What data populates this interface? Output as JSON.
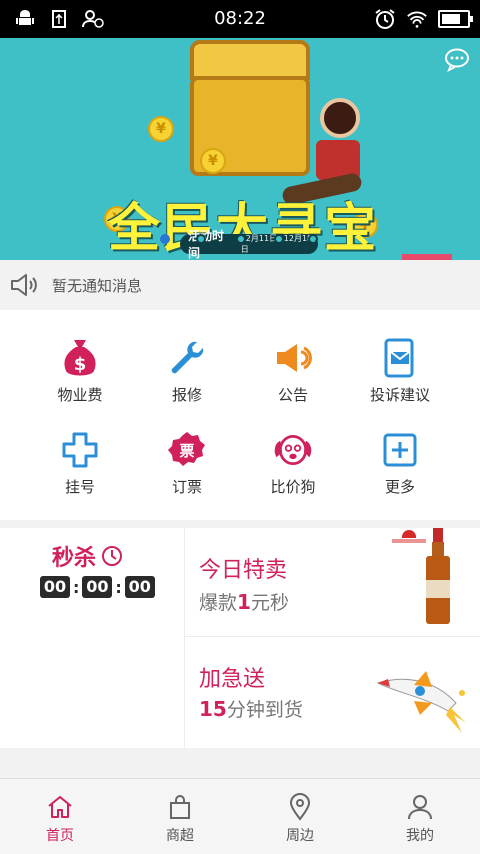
{
  "status_bar": {
    "time": "08:22",
    "battery_level": 0.75
  },
  "banner": {
    "headline": "全民大寻宝",
    "event_label": "活动时间",
    "event_dates": "12月11日~12月18日",
    "coin_symbol": "¥"
  },
  "notice": {
    "text": "暂无通知消息"
  },
  "grid": {
    "items": [
      {
        "label": "物业费",
        "icon": "money-bag-icon",
        "color": "#d0215b"
      },
      {
        "label": "报修",
        "icon": "wrench-icon",
        "color": "#2a8fd6"
      },
      {
        "label": "公告",
        "icon": "megaphone-icon",
        "color": "#ef8a1f"
      },
      {
        "label": "投诉建议",
        "icon": "mail-phone-icon",
        "color": "#2a8fd6"
      },
      {
        "label": "挂号",
        "icon": "medical-cross-icon",
        "color": "#2a8fd6"
      },
      {
        "label": "订票",
        "icon": "ticket-badge-icon",
        "color": "#d0215b",
        "badge_text": "票"
      },
      {
        "label": "比价狗",
        "icon": "dog-icon",
        "color": "#d0215b"
      },
      {
        "label": "更多",
        "icon": "plus-square-icon",
        "color": "#2a8fd6"
      }
    ]
  },
  "promo": {
    "flash_sale": {
      "title": "秒杀",
      "hours": "00",
      "minutes": "00",
      "seconds": "00"
    },
    "today_special": {
      "title": "今日特卖",
      "sub_prefix": "爆款",
      "sub_highlight": "1",
      "sub_suffix": "元秒"
    },
    "express": {
      "title": "加急送",
      "sub_highlight": "15",
      "sub_suffix": "分钟到货"
    }
  },
  "bottom_nav": {
    "tabs": [
      {
        "label": "首页",
        "icon": "home-icon",
        "active": true
      },
      {
        "label": "商超",
        "icon": "shopping-bag-icon",
        "active": false
      },
      {
        "label": "周边",
        "icon": "location-pin-icon",
        "active": false
      },
      {
        "label": "我的",
        "icon": "user-icon",
        "active": false
      }
    ]
  },
  "colors": {
    "accent": "#d0215b",
    "blue": "#2a8fd6",
    "orange": "#ef8a1f",
    "banner_bg": "#3fc0c6"
  }
}
